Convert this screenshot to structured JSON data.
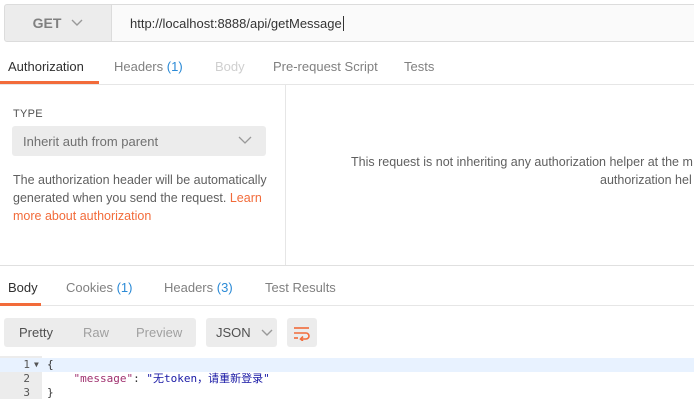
{
  "request": {
    "method": "GET",
    "url": "http://localhost:8888/api/getMessage"
  },
  "request_tabs": [
    {
      "label": "Authorization",
      "count": "",
      "state": "active"
    },
    {
      "label": "Headers",
      "count": "(1)",
      "state": "normal"
    },
    {
      "label": "Body",
      "count": "",
      "state": "disabled"
    },
    {
      "label": "Pre-request Script",
      "count": "",
      "state": "normal"
    },
    {
      "label": "Tests",
      "count": "",
      "state": "normal"
    }
  ],
  "auth": {
    "type_label": "TYPE",
    "type_value": "Inherit auth from parent",
    "note": "The authorization header will be automatically generated when you send the request.",
    "note_link": "Learn more about authorization",
    "message_line1": "This request is not inheriting any authorization helper at the m",
    "message_line2": "authorization hel"
  },
  "response_tabs": [
    {
      "label": "Body",
      "count": "",
      "state": "active"
    },
    {
      "label": "Cookies",
      "count": "(1)",
      "state": "normal"
    },
    {
      "label": "Headers",
      "count": "(3)",
      "state": "normal"
    },
    {
      "label": "Test Results",
      "count": "",
      "state": "normal"
    }
  ],
  "view_modes": [
    "Pretty",
    "Raw",
    "Preview"
  ],
  "active_view_mode": "Pretty",
  "format": "JSON",
  "code": {
    "line_numbers": [
      "1",
      "2",
      "3"
    ],
    "line1": "{",
    "key": "\"message\"",
    "colon": ": ",
    "value": "\"无token，请重新登录\"",
    "line3": "}"
  },
  "colors": {
    "accent": "#f26b3a",
    "count": "#2b8ad6"
  }
}
